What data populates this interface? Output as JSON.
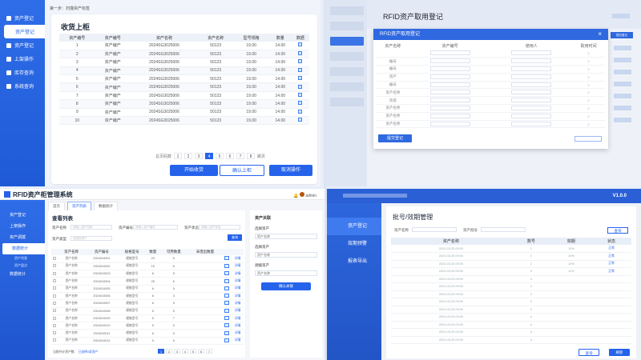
{
  "q1": {
    "breadcrumb": "第一步：扫描资产标签",
    "nav": [
      {
        "label": "资产登记",
        "sub": false,
        "active": false
      },
      {
        "label": "资产登记",
        "sub": true,
        "active": true
      },
      {
        "label": "资产登记",
        "sub": false,
        "active": false
      },
      {
        "label": "上架操作",
        "sub": false,
        "active": false
      },
      {
        "label": "库存查询",
        "sub": false,
        "active": false
      },
      {
        "label": "系统查询",
        "sub": false,
        "active": false
      }
    ],
    "title": "收货上柜",
    "columns": [
      "资产编号",
      "资产编号",
      "资产名称",
      "资产名称",
      "型号规格",
      "数量",
      "数据"
    ],
    "rows": [
      [
        "1",
        "资产编产",
        "2024SG3025006",
        "50123",
        "19.00",
        "14.00"
      ],
      [
        "2",
        "资产编产",
        "2024SG3025006",
        "50123",
        "19.00",
        "14.00"
      ],
      [
        "3",
        "资产编产",
        "2024SG3025006",
        "50123",
        "19.00",
        "14.00"
      ],
      [
        "4",
        "资产编产",
        "2024SG3025006",
        "50123",
        "19.00",
        "14.00"
      ],
      [
        "5",
        "资产编产",
        "2024SG3025006",
        "50123",
        "19.00",
        "14.00"
      ],
      [
        "6",
        "资产编产",
        "2024SG3025006",
        "50123",
        "19.00",
        "14.00"
      ],
      [
        "7",
        "资产编产",
        "2024SG3025006",
        "50123",
        "19.00",
        "14.00"
      ],
      [
        "8",
        "资产编产",
        "2024SG3025006",
        "50123",
        "19.00",
        "14.00"
      ],
      [
        "9",
        "资产编产",
        "2024SG3025006",
        "50123",
        "19.00",
        "14.00"
      ],
      [
        "10",
        "资产编产",
        "2024SG3025006",
        "50123",
        "19.00",
        "14.00"
      ]
    ],
    "pager_prefix": "总页码数",
    "pages": [
      "1",
      "2",
      "3",
      "4",
      "5",
      "6",
      "7",
      "8"
    ],
    "current_page": "4",
    "pager_suffix": "跳页",
    "buttons": {
      "start": "开始收货",
      "confirm": "确认上柜",
      "cancel": "取消操作"
    }
  },
  "q2": {
    "title": "RFID资产取用登记",
    "dialog_title": "RFID资产取用登记",
    "close": "×",
    "columns": [
      "资产名称",
      "资产编号",
      "使用人",
      "取用时间",
      "",
      ""
    ],
    "rows": [
      [
        "",
        "",
        "",
        "",
        "",
        "",
        ""
      ],
      [
        "编号",
        "",
        "",
        "",
        ""
      ],
      [
        "编号",
        "",
        "",
        "",
        ""
      ],
      [
        "资产",
        "",
        "",
        "",
        ""
      ],
      [
        "编号",
        "",
        "",
        "",
        ""
      ],
      [
        "资产名称",
        "",
        "",
        "",
        ""
      ],
      [
        "资提",
        "",
        "",
        "",
        ""
      ],
      [
        "资产名称",
        "",
        "",
        "",
        ""
      ],
      [
        "资产名称",
        "",
        "",
        "",
        ""
      ],
      [
        "资产名称",
        "",
        "",
        "",
        ""
      ]
    ],
    "submit": "提交登记",
    "right_btn": "提交登记"
  },
  "q3": {
    "app_title": "RFID资产柜管理系统",
    "user": "admin",
    "nav": [
      {
        "label": "资产登记",
        "cls": "nav"
      },
      {
        "label": "上架操作",
        "cls": "nav"
      },
      {
        "label": "资产调拨",
        "cls": "nav"
      },
      {
        "label": "数据统计",
        "cls": "nav on"
      },
      {
        "label": "资产列表",
        "cls": "nav sub"
      },
      {
        "label": "资产盘点",
        "cls": "nav sub"
      },
      {
        "label": "数据统计",
        "cls": "nav"
      }
    ],
    "tabs": [
      "首页",
      "资产列表",
      "数据统计"
    ],
    "heading": "查看列表",
    "filters": {
      "asset_name_label": "资产名称",
      "asset_name_ph": "请输入资产名称",
      "asset_no_label": "资产编号",
      "asset_no_ph": "请输入资产编号",
      "status_label": "资产状态",
      "status_ph": "请输入资产状态",
      "type_label": "资产类型",
      "type_ph": "请选择资产",
      "search": "查询"
    },
    "columns": [
      "",
      "资产名称",
      "资产编号",
      "规格型号",
      "数量",
      "可用数量",
      "未借出数量",
      "",
      ""
    ],
    "rows": [
      [
        "",
        "资产名称",
        "2024010001",
        "规格型号",
        "23",
        "5",
        "",
        "",
        "详情"
      ],
      [
        "",
        "资产名称",
        "2024010002",
        "规格型号",
        "15",
        "5",
        "",
        "",
        "详情"
      ],
      [
        "",
        "资产名称",
        "2024010003",
        "规格型号",
        "8",
        "5",
        "",
        "",
        "详情"
      ],
      [
        "",
        "资产名称",
        "2024010004",
        "规格型号",
        "25",
        "6",
        "",
        "",
        "详情"
      ],
      [
        "",
        "资产名称",
        "2024010005",
        "规格型号",
        "6",
        "5",
        "",
        "",
        "详情"
      ],
      [
        "",
        "资产名称",
        "2024010006",
        "规格型号",
        "6",
        "3",
        "",
        "",
        "详情"
      ],
      [
        "",
        "资产名称",
        "2024010007",
        "规格型号",
        "6",
        "5",
        "",
        "",
        "详情"
      ],
      [
        "",
        "资产名称",
        "2024010008",
        "规格型号",
        "5",
        "5",
        "",
        "",
        "详情"
      ],
      [
        "",
        "资产名称",
        "2024010009",
        "规格型号",
        "5",
        "7",
        "",
        "",
        "详情"
      ],
      [
        "",
        "资产名称",
        "2024010010",
        "规格型号",
        "5",
        "5",
        "",
        "",
        "详情"
      ],
      [
        "",
        "资产名称",
        "2024010011",
        "规格型号",
        "6",
        "5",
        "",
        "",
        "详情"
      ],
      [
        "",
        "资产名称",
        "2024010012",
        "规格型号",
        "5",
        "5",
        "",
        "",
        "详情"
      ]
    ],
    "footer_text": "当前共计资产数：",
    "footer_link": "已选择0条资产",
    "pages": [
      "1",
      "2",
      "3",
      "4",
      "5",
      "6",
      "7"
    ],
    "panel": {
      "title": "资产关联",
      "items": [
        "选择资产",
        "选择资产",
        "调拨资产",
        "确认关联"
      ],
      "select_text": "资产名称",
      "confirm": "确认关联"
    }
  },
  "q4": {
    "version": "V1.0.0",
    "nav": [
      {
        "label": "资产登记",
        "active": true
      },
      {
        "label": "效期预警",
        "active": false
      },
      {
        "label": "报表导出",
        "active": false
      }
    ],
    "heading": "批号/效期管理",
    "filter_label1": "资产名称",
    "filter_label2": "资产批号",
    "search": "查询",
    "columns": [
      "资产名称",
      "数号",
      "效期",
      "状态"
    ],
    "rows": [
      [
        "2024-03-25 09:00",
        "1",
        "10%",
        "正常"
      ],
      [
        "2024-03-25 09:00",
        "2",
        "10%",
        "正常"
      ],
      [
        "2024-03-25 09:00",
        "2",
        "10%",
        "正常"
      ],
      [
        "2024-03-25 09:00",
        "3",
        "10%",
        "正常"
      ],
      [
        "2024-03-25 09:00",
        "4",
        "",
        ""
      ],
      [
        "2024-03-25 09:00",
        "4",
        "",
        ""
      ],
      [
        "2024-03-25 09:00",
        "4",
        "",
        ""
      ],
      [
        "2024-03-25 09:00",
        "4",
        "",
        ""
      ],
      [
        "2024-03-25 09:00",
        "4",
        "",
        ""
      ],
      [
        "2024-03-25 09:00",
        "4",
        "",
        ""
      ],
      [
        "2024-03-25 09:00",
        "4",
        "",
        ""
      ],
      [
        "2024-03-25 09:00",
        "4",
        "",
        ""
      ],
      [
        "2024-03-25 09:00",
        "4",
        "",
        ""
      ]
    ],
    "btn_query": "查询",
    "btn_refresh": "刷新"
  }
}
